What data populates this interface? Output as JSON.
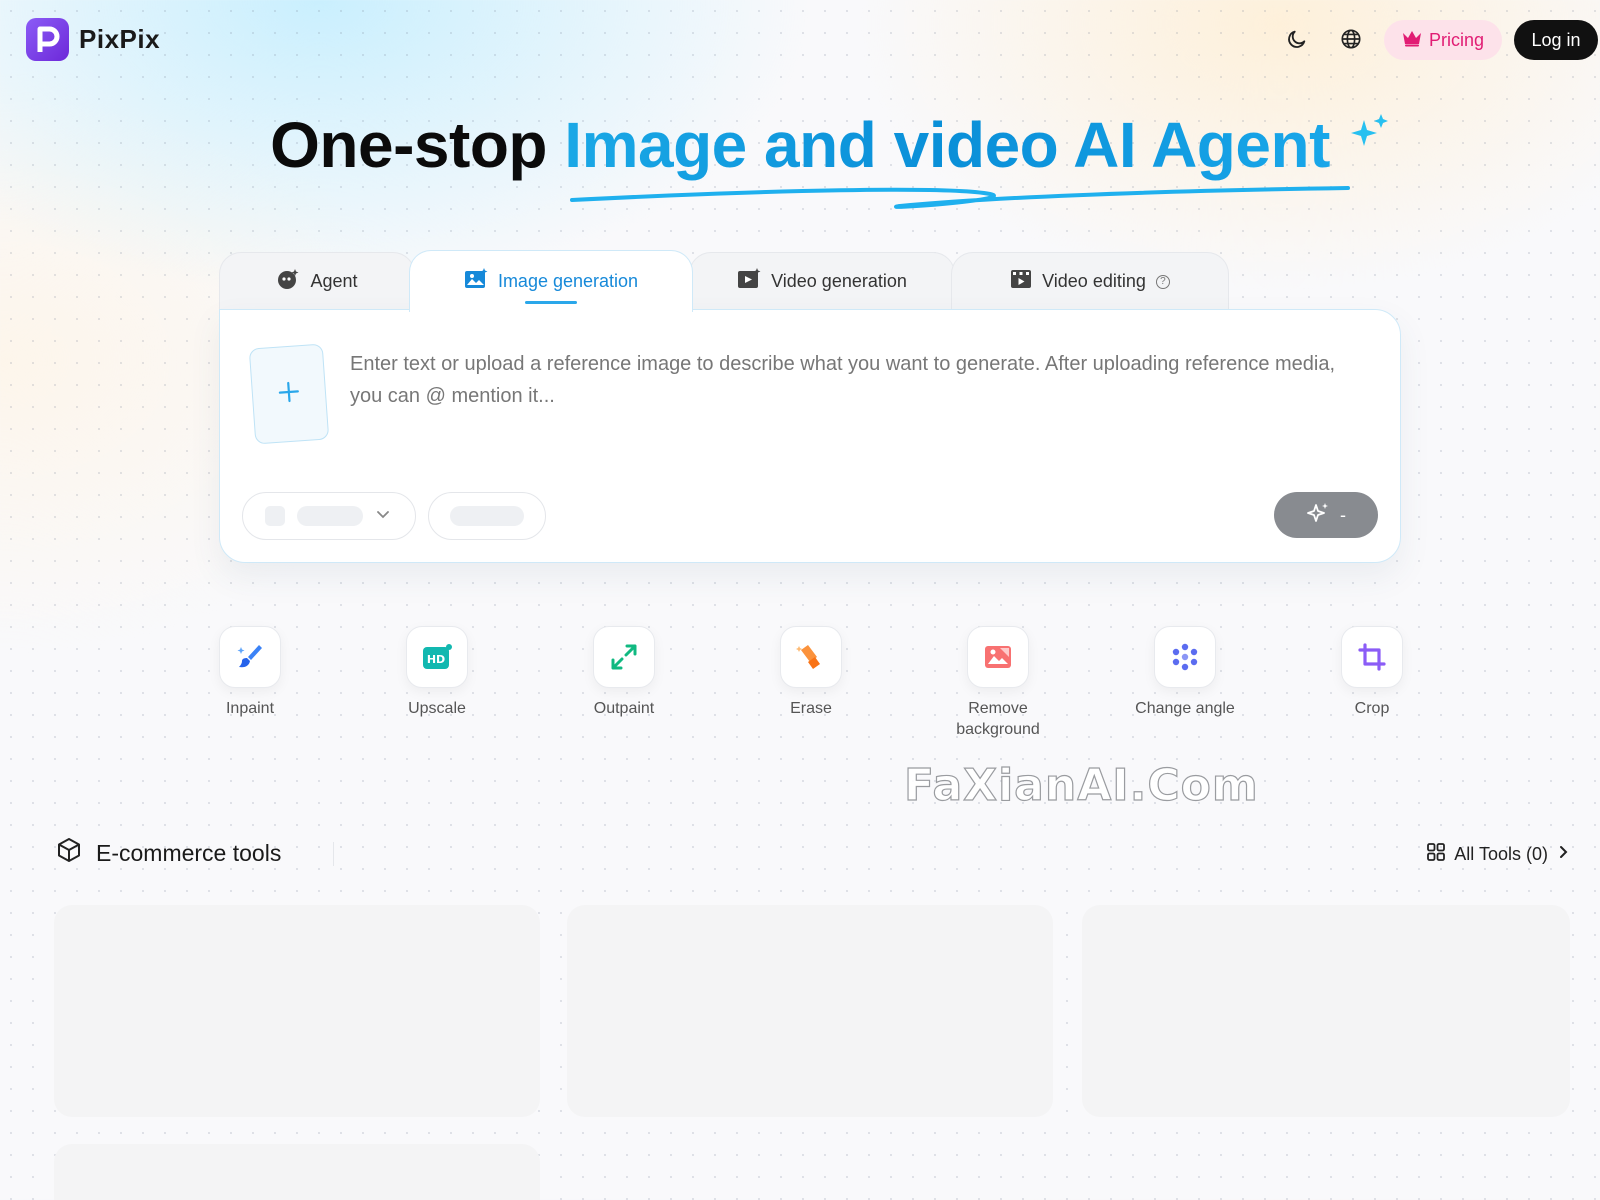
{
  "brand": {
    "name": "PixPix",
    "accent": "#7c3aed"
  },
  "header": {
    "theme_toggle_icon": "moon-icon",
    "language_icon": "globe-icon",
    "pricing_label": "Pricing",
    "pricing_icon": "crown-icon",
    "login_label": "Log in"
  },
  "hero": {
    "title_plain": "One-stop",
    "title_accent": "Image and video AI Agent"
  },
  "tabs": [
    {
      "label": "Agent",
      "icon": "agent-icon",
      "active": false
    },
    {
      "label": "Image generation",
      "icon": "image-icon",
      "active": true
    },
    {
      "label": "Video generation",
      "icon": "video-icon",
      "active": false
    },
    {
      "label": "Video editing",
      "icon": "film-icon",
      "active": false,
      "help": "?"
    }
  ],
  "composer": {
    "placeholder": "Enter text or upload a reference image to describe what you want to generate. After uploading reference media, you can @ mention it...",
    "upload_icon": "plus-icon",
    "generate_label": "-"
  },
  "tools": [
    {
      "label": "Inpaint",
      "icon": "brush-icon"
    },
    {
      "label": "Upscale",
      "icon": "hd-icon"
    },
    {
      "label": "Outpaint",
      "icon": "expand-icon"
    },
    {
      "label": "Erase",
      "icon": "eraser-icon"
    },
    {
      "label": "Remove background",
      "icon": "remove-bg-icon"
    },
    {
      "label": "Change angle",
      "icon": "angle-icon"
    },
    {
      "label": "Crop",
      "icon": "crop-icon"
    }
  ],
  "watermark": "FaXianAI.Com",
  "ecommerce": {
    "title": "E-commerce tools",
    "all_tools_label": "All Tools (0)"
  }
}
